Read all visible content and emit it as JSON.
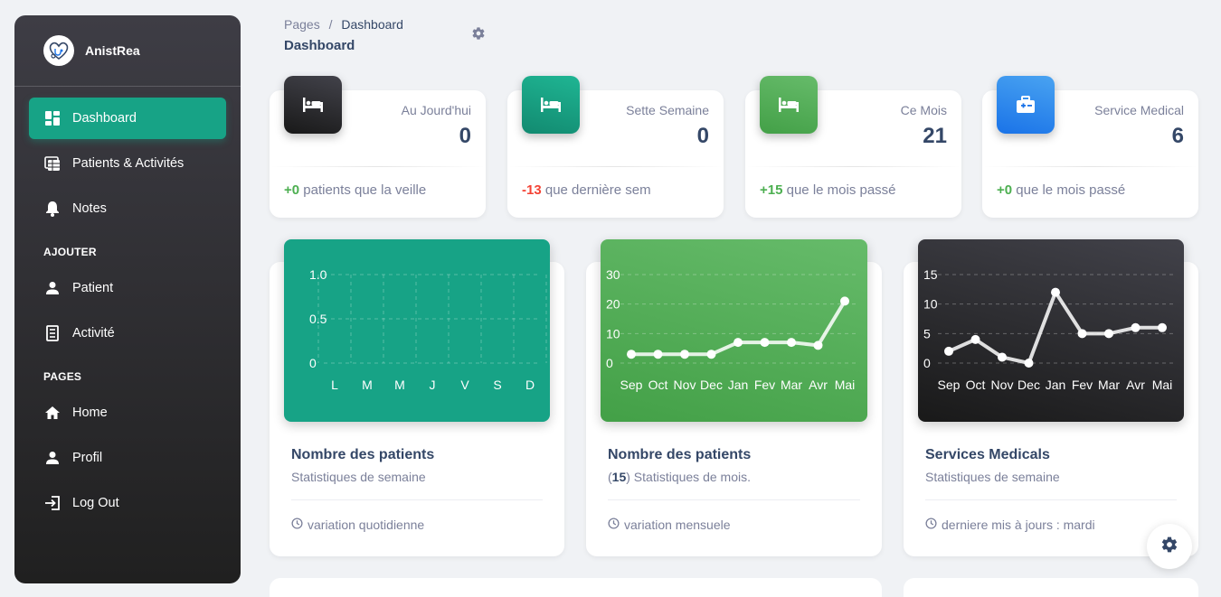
{
  "app": {
    "name": "AnistRea"
  },
  "breadcrumb": {
    "root": "Pages",
    "separator": "/",
    "current": "Dashboard"
  },
  "page_title": "Dashboard",
  "sidebar": {
    "items": [
      {
        "label": "Dashboard",
        "icon": "dashboard-icon",
        "active": true
      },
      {
        "label": "Patients & Activités",
        "icon": "table-icon"
      },
      {
        "label": "Notes",
        "icon": "bell-icon"
      }
    ],
    "section_add": "AJOUTER",
    "add_items": [
      {
        "label": "Patient",
        "icon": "person-icon"
      },
      {
        "label": "Activité",
        "icon": "receipt-icon"
      }
    ],
    "section_pages": "PAGES",
    "page_items": [
      {
        "label": "Home",
        "icon": "home-icon"
      },
      {
        "label": "Profil",
        "icon": "person-icon"
      },
      {
        "label": "Log Out",
        "icon": "logout-icon"
      }
    ]
  },
  "stats": [
    {
      "label": "Au Jourd'hui",
      "value": "0",
      "delta": "+0",
      "delta_text": " patients que la veille",
      "color": "#2d2d31",
      "icon": "bed-icon"
    },
    {
      "label": "Sette Semaine",
      "value": "0",
      "delta": "-13",
      "delta_text": " que dernière sem",
      "color": "#17a386",
      "icon": "bed-icon"
    },
    {
      "label": "Ce Mois",
      "value": "21",
      "delta": "+15",
      "delta_text": " que le mois passé",
      "color": "#4caf50",
      "icon": "bed-icon"
    },
    {
      "label": "Service Medical",
      "value": "6",
      "delta": "+0",
      "delta_text": " que le mois passé",
      "color": "#1a73e8",
      "icon": "medical-kit-icon"
    }
  ],
  "charts": [
    {
      "title": "Nombre des patients",
      "subtitle": "Statistiques de semaine",
      "footer": "variation quotidienne",
      "bg": "#17a386"
    },
    {
      "title": "Nombre des patients",
      "subtitle_count": "15",
      "subtitle_open": "(",
      "subtitle_rest": ") Statistiques de mois.",
      "footer": "variation mensuele",
      "bg": "#4caf50"
    },
    {
      "title": "Services Medicals",
      "subtitle": "Statistiques de semaine",
      "footer": "derniere mis à jours : mardi",
      "bg": "#2a2a2e"
    }
  ],
  "chart_data": [
    {
      "type": "bar",
      "categories": [
        "L",
        "M",
        "M",
        "J",
        "V",
        "S",
        "D"
      ],
      "values": [
        0,
        0,
        0,
        0,
        0,
        0,
        0
      ],
      "yticks": [
        "1.0",
        "0.5",
        "0"
      ],
      "ylim": [
        0,
        1
      ],
      "grid": true
    },
    {
      "type": "line",
      "categories": [
        "Sep",
        "Oct",
        "Nov",
        "Dec",
        "Jan",
        "Fev",
        "Mar",
        "Avr",
        "Mai"
      ],
      "values": [
        3,
        3,
        3,
        3,
        7,
        7,
        7,
        6,
        21
      ],
      "yticks": [
        "30",
        "20",
        "10",
        "0"
      ],
      "ylim": [
        0,
        30
      ],
      "grid": true
    },
    {
      "type": "line",
      "categories": [
        "Sep",
        "Oct",
        "Nov",
        "Dec",
        "Jan",
        "Fev",
        "Mar",
        "Avr",
        "Mai"
      ],
      "values": [
        2,
        4,
        1,
        0,
        12,
        5,
        5,
        6,
        6
      ],
      "yticks": [
        "15",
        "10",
        "5",
        "0"
      ],
      "ylim": [
        0,
        15
      ],
      "grid": true
    }
  ]
}
